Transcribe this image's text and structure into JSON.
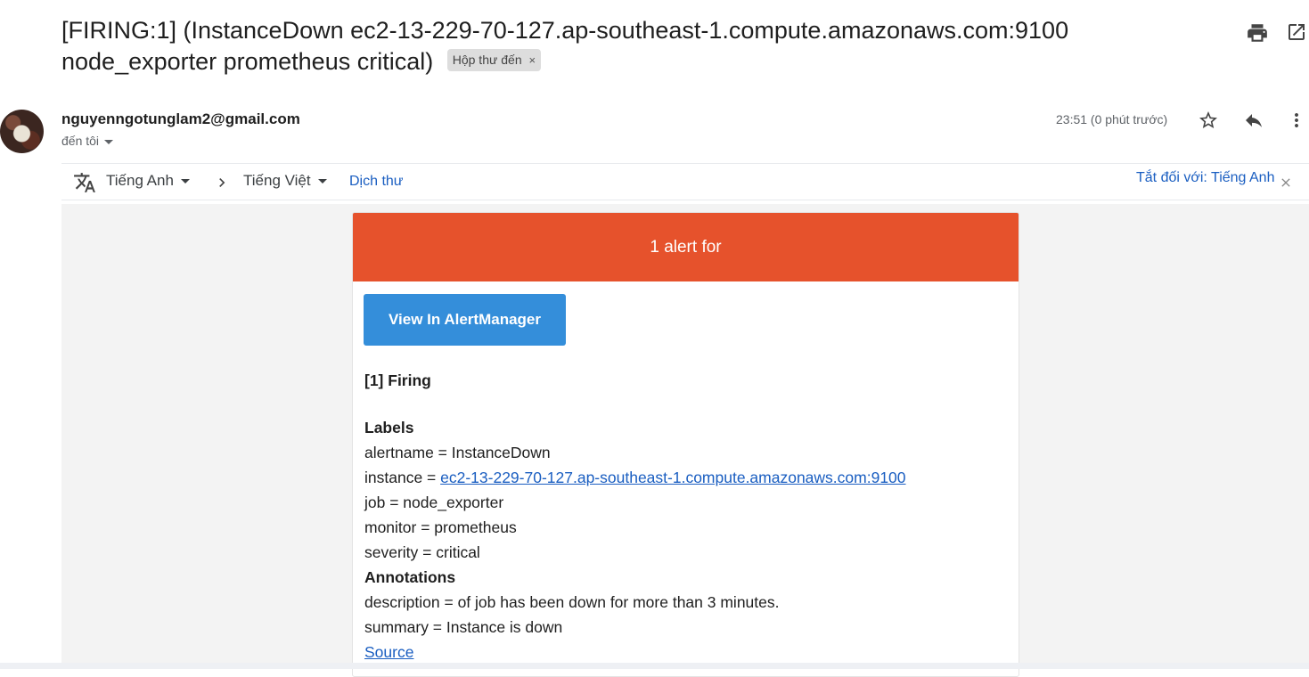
{
  "subject": {
    "text": "[FIRING:1] (InstanceDown ec2-13-229-70-127.ap-southeast-1.compute.amazonaws.com:9100 node_exporter prometheus critical)",
    "label": "Hộp thư đến",
    "label_close": "×"
  },
  "icons": {
    "print": "print-icon",
    "open_new": "open-in-new-window-icon",
    "star": "star-icon",
    "reply": "reply-icon",
    "more": "more-vert-icon",
    "translate": "translate-icon",
    "arrow": "chevron-right-icon",
    "close": "close-icon"
  },
  "message": {
    "sender": "nguyenngotunglam2@gmail.com",
    "to": "đến tôi",
    "time": "23:51 (0 phút trước)"
  },
  "translate_bar": {
    "from_lang": "Tiếng Anh",
    "to_lang": "Tiếng Việt",
    "translate_link": "Dịch thư",
    "turn_off": "Tắt đối với: Tiếng Anh"
  },
  "alert": {
    "header": "1 alert for",
    "button": "View In AlertManager",
    "firing": "[1] Firing",
    "labels_title": "Labels",
    "alertname": "alertname = InstanceDown",
    "instance_prefix": "instance = ",
    "instance_link": "ec2-13-229-70-127.ap-southeast-1.compute.amazonaws.com:9100",
    "job": "job = node_exporter",
    "monitor": "monitor = prometheus",
    "severity": "severity = critical",
    "annotations_title": "Annotations",
    "description": "description = of job has been down for more than 3 minutes.",
    "summary": "summary = Instance is down",
    "source": "Source"
  },
  "colors": {
    "header_red": "#e6522c",
    "button_blue": "#348eda",
    "link_blue": "#1a5ec1"
  }
}
